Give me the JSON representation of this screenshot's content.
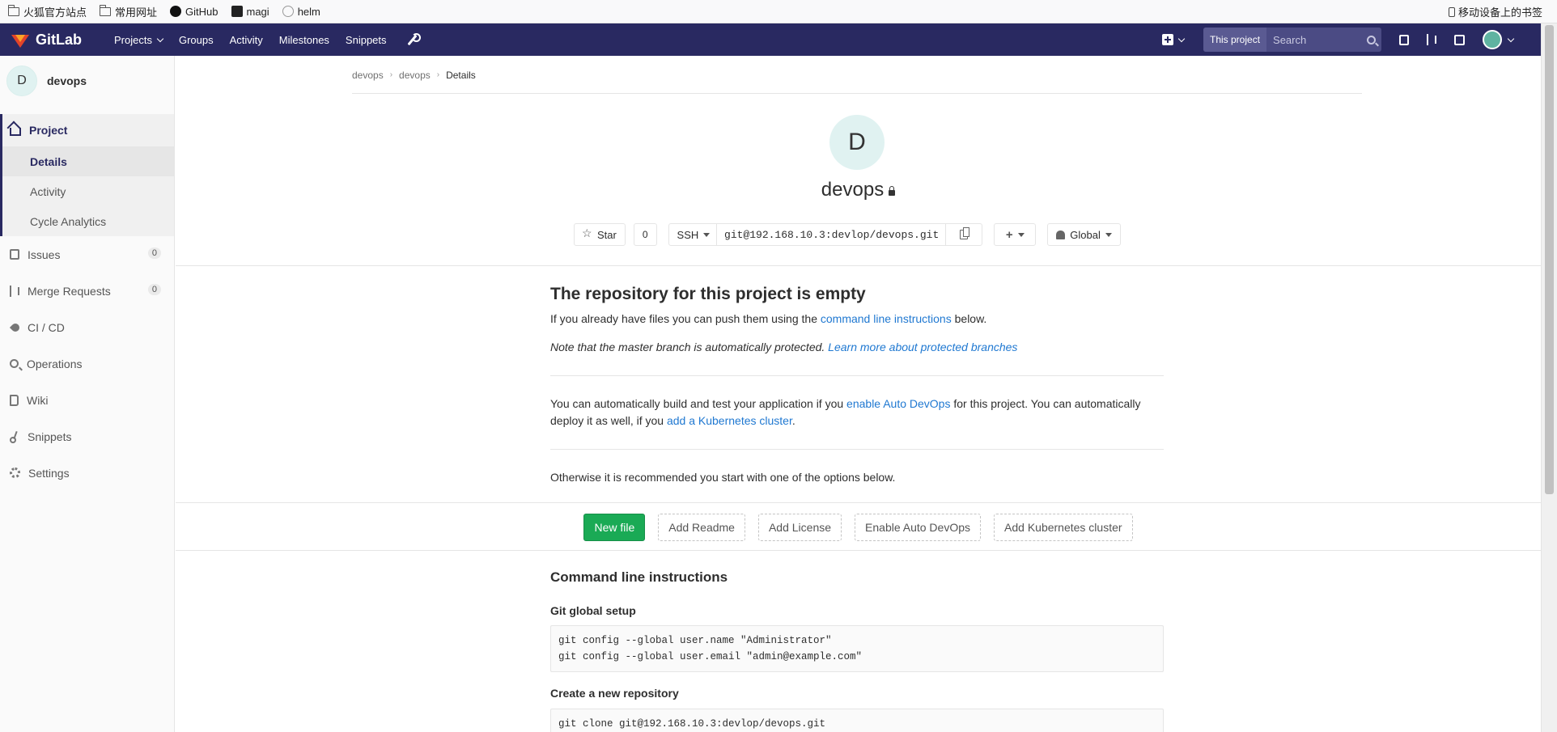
{
  "bookmarks": {
    "items": [
      {
        "label": "火狐官方站点",
        "icon": "folder-icon"
      },
      {
        "label": "常用网址",
        "icon": "folder-icon"
      },
      {
        "label": "GitHub",
        "icon": "github-icon"
      },
      {
        "label": "magi",
        "icon": "magi-icon"
      },
      {
        "label": "helm",
        "icon": "globe-icon"
      }
    ],
    "mobile": "移动设备上的书签"
  },
  "navbar": {
    "brand": "GitLab",
    "links": [
      "Projects",
      "Groups",
      "Activity",
      "Milestones",
      "Snippets"
    ],
    "scope": "This project",
    "search_placeholder": "Search"
  },
  "sidebar": {
    "project_initial": "D",
    "project_name": "devops",
    "project_section": "Project",
    "subitems": [
      "Details",
      "Activity",
      "Cycle Analytics"
    ],
    "issues": {
      "label": "Issues",
      "count": "0"
    },
    "merge_requests": {
      "label": "Merge Requests",
      "count": "0"
    },
    "items": [
      "CI / CD",
      "Operations",
      "Wiki",
      "Snippets",
      "Settings"
    ]
  },
  "breadcrumb": {
    "items": [
      "devops",
      "devops",
      "Details"
    ]
  },
  "project": {
    "initial": "D",
    "name": "devops",
    "star_label": "Star",
    "star_count": "0",
    "protocol": "SSH",
    "clone_url": "git@192.168.10.3:devlop/devops.git",
    "notification": "Global"
  },
  "empty": {
    "title": "The repository for this project is empty",
    "p1_before": "If you already have files you can push them using the ",
    "p1_link": "command line instructions",
    "p1_after": " below.",
    "p2_text": "Note that the master branch is automatically protected. ",
    "p2_link": "Learn more about protected branches",
    "p3_before": "You can automatically build and test your application if you ",
    "p3_link1": "enable Auto DevOps",
    "p3_mid": " for this project. You can automatically deploy it as well, if you ",
    "p3_link2": "add a Kubernetes cluster",
    "p3_after": ".",
    "p4": "Otherwise it is recommended you start with one of the options below."
  },
  "buttons": {
    "new_file": "New file",
    "add_readme": "Add Readme",
    "add_license": "Add License",
    "enable_auto_devops": "Enable Auto DevOps",
    "add_k8s": "Add Kubernetes cluster"
  },
  "cli": {
    "title": "Command line instructions",
    "global_setup": "Git global setup",
    "global_code": "git config --global user.name \"Administrator\"\ngit config --global user.email \"admin@example.com\"",
    "new_repo": "Create a new repository",
    "new_repo_code": "git clone git@192.168.10.3:devlop/devops.git"
  }
}
